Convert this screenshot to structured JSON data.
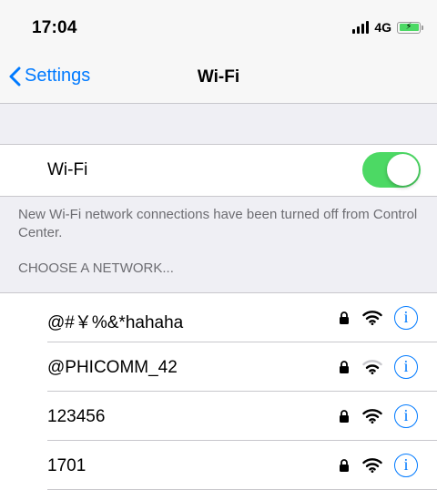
{
  "status_bar": {
    "time": "17:04",
    "network_type": "4G",
    "battery_color": "#4cd964",
    "battery_icon": "battery-charging-icon",
    "battery_bolt": "⚡",
    "signal_icon": "cellular-signal-icon"
  },
  "nav": {
    "back_label": "Settings",
    "title": "Wi-Fi",
    "back_icon": "chevron-left-icon"
  },
  "wifi_toggle": {
    "label": "Wi-Fi",
    "state": "on",
    "on_color": "#4cd964"
  },
  "notice": "New Wi-Fi network connections have been turned off from Control Center.",
  "networks_header": "CHOOSE A NETWORK...",
  "networks": [
    {
      "name": "@#￥%&*hahaha",
      "secured": true,
      "signal_strength": 3
    },
    {
      "name": "@PHICOMM_42",
      "secured": true,
      "signal_strength": 2
    },
    {
      "name": "123456",
      "secured": true,
      "signal_strength": 3
    },
    {
      "name": "1701",
      "secured": true,
      "signal_strength": 3
    }
  ],
  "colors": {
    "accent": "#007aff",
    "background": "#efeff4",
    "secondary_text": "#6d6d72",
    "separator": "#c8c7cc"
  },
  "icons": {
    "lock": "lock-icon",
    "wifi": "wifi-signal-icon",
    "info": "info-icon",
    "info_glyph": "i"
  }
}
